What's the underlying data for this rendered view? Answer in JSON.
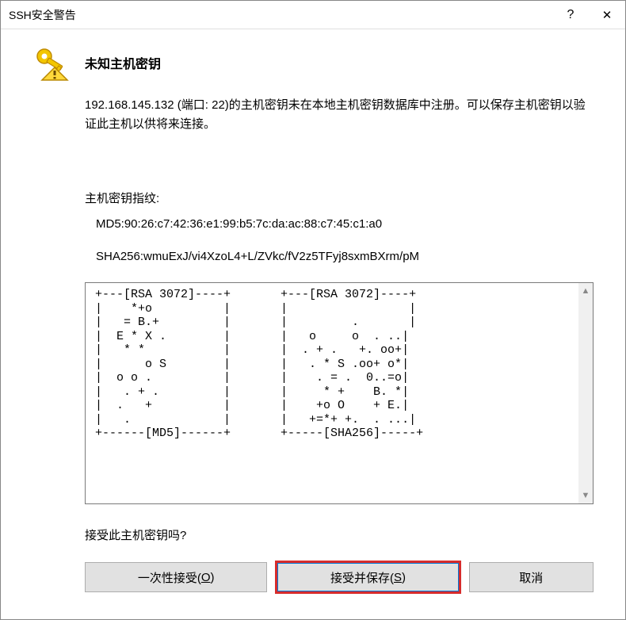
{
  "titlebar": {
    "title": "SSH安全警告"
  },
  "heading": "未知主机密钥",
  "body": "192.168.145.132 (端口: 22)的主机密钥未在本地主机密钥数据库中注册。可以保存主机密钥以验证此主机以供将来连接。",
  "fingerprint_label": "主机密钥指纹:",
  "md5": "MD5:90:26:c7:42:36:e1:99:b5:7c:da:ac:88:c7:45:c1:a0",
  "sha256": "SHA256:wmuExJ/vi4XzoL4+L/ZVkc/fV2z5TFyj8sxmBXrm/pM",
  "art": "+---[RSA 3072]----+       +---[RSA 3072]----+\n|    *+o          |       |                 |\n|   = B.+         |       |         .       |\n|  E * X .        |       |   o     o  . ..|\n|   * *           |       |  . + .   +. oo+|\n|      o S        |       |   . * S .oo+ o*|\n|  o o .          |       |    . = .  0..=o|\n|   . + .         |       |     * +    B. *|\n|  .   +          |       |    +o O    + E.|\n|   .             |       |   +=*+ +.  . ...|\n+------[MD5]------+       +-----[SHA256]-----+",
  "accept_label": "接受此主机密钥吗?",
  "buttons": {
    "accept_once_pre": "一次性接受(",
    "accept_once_key": "O",
    "accept_once_post": ")",
    "accept_save_pre": "接受并保存(",
    "accept_save_key": "S",
    "accept_save_post": ")",
    "cancel": "取消"
  }
}
